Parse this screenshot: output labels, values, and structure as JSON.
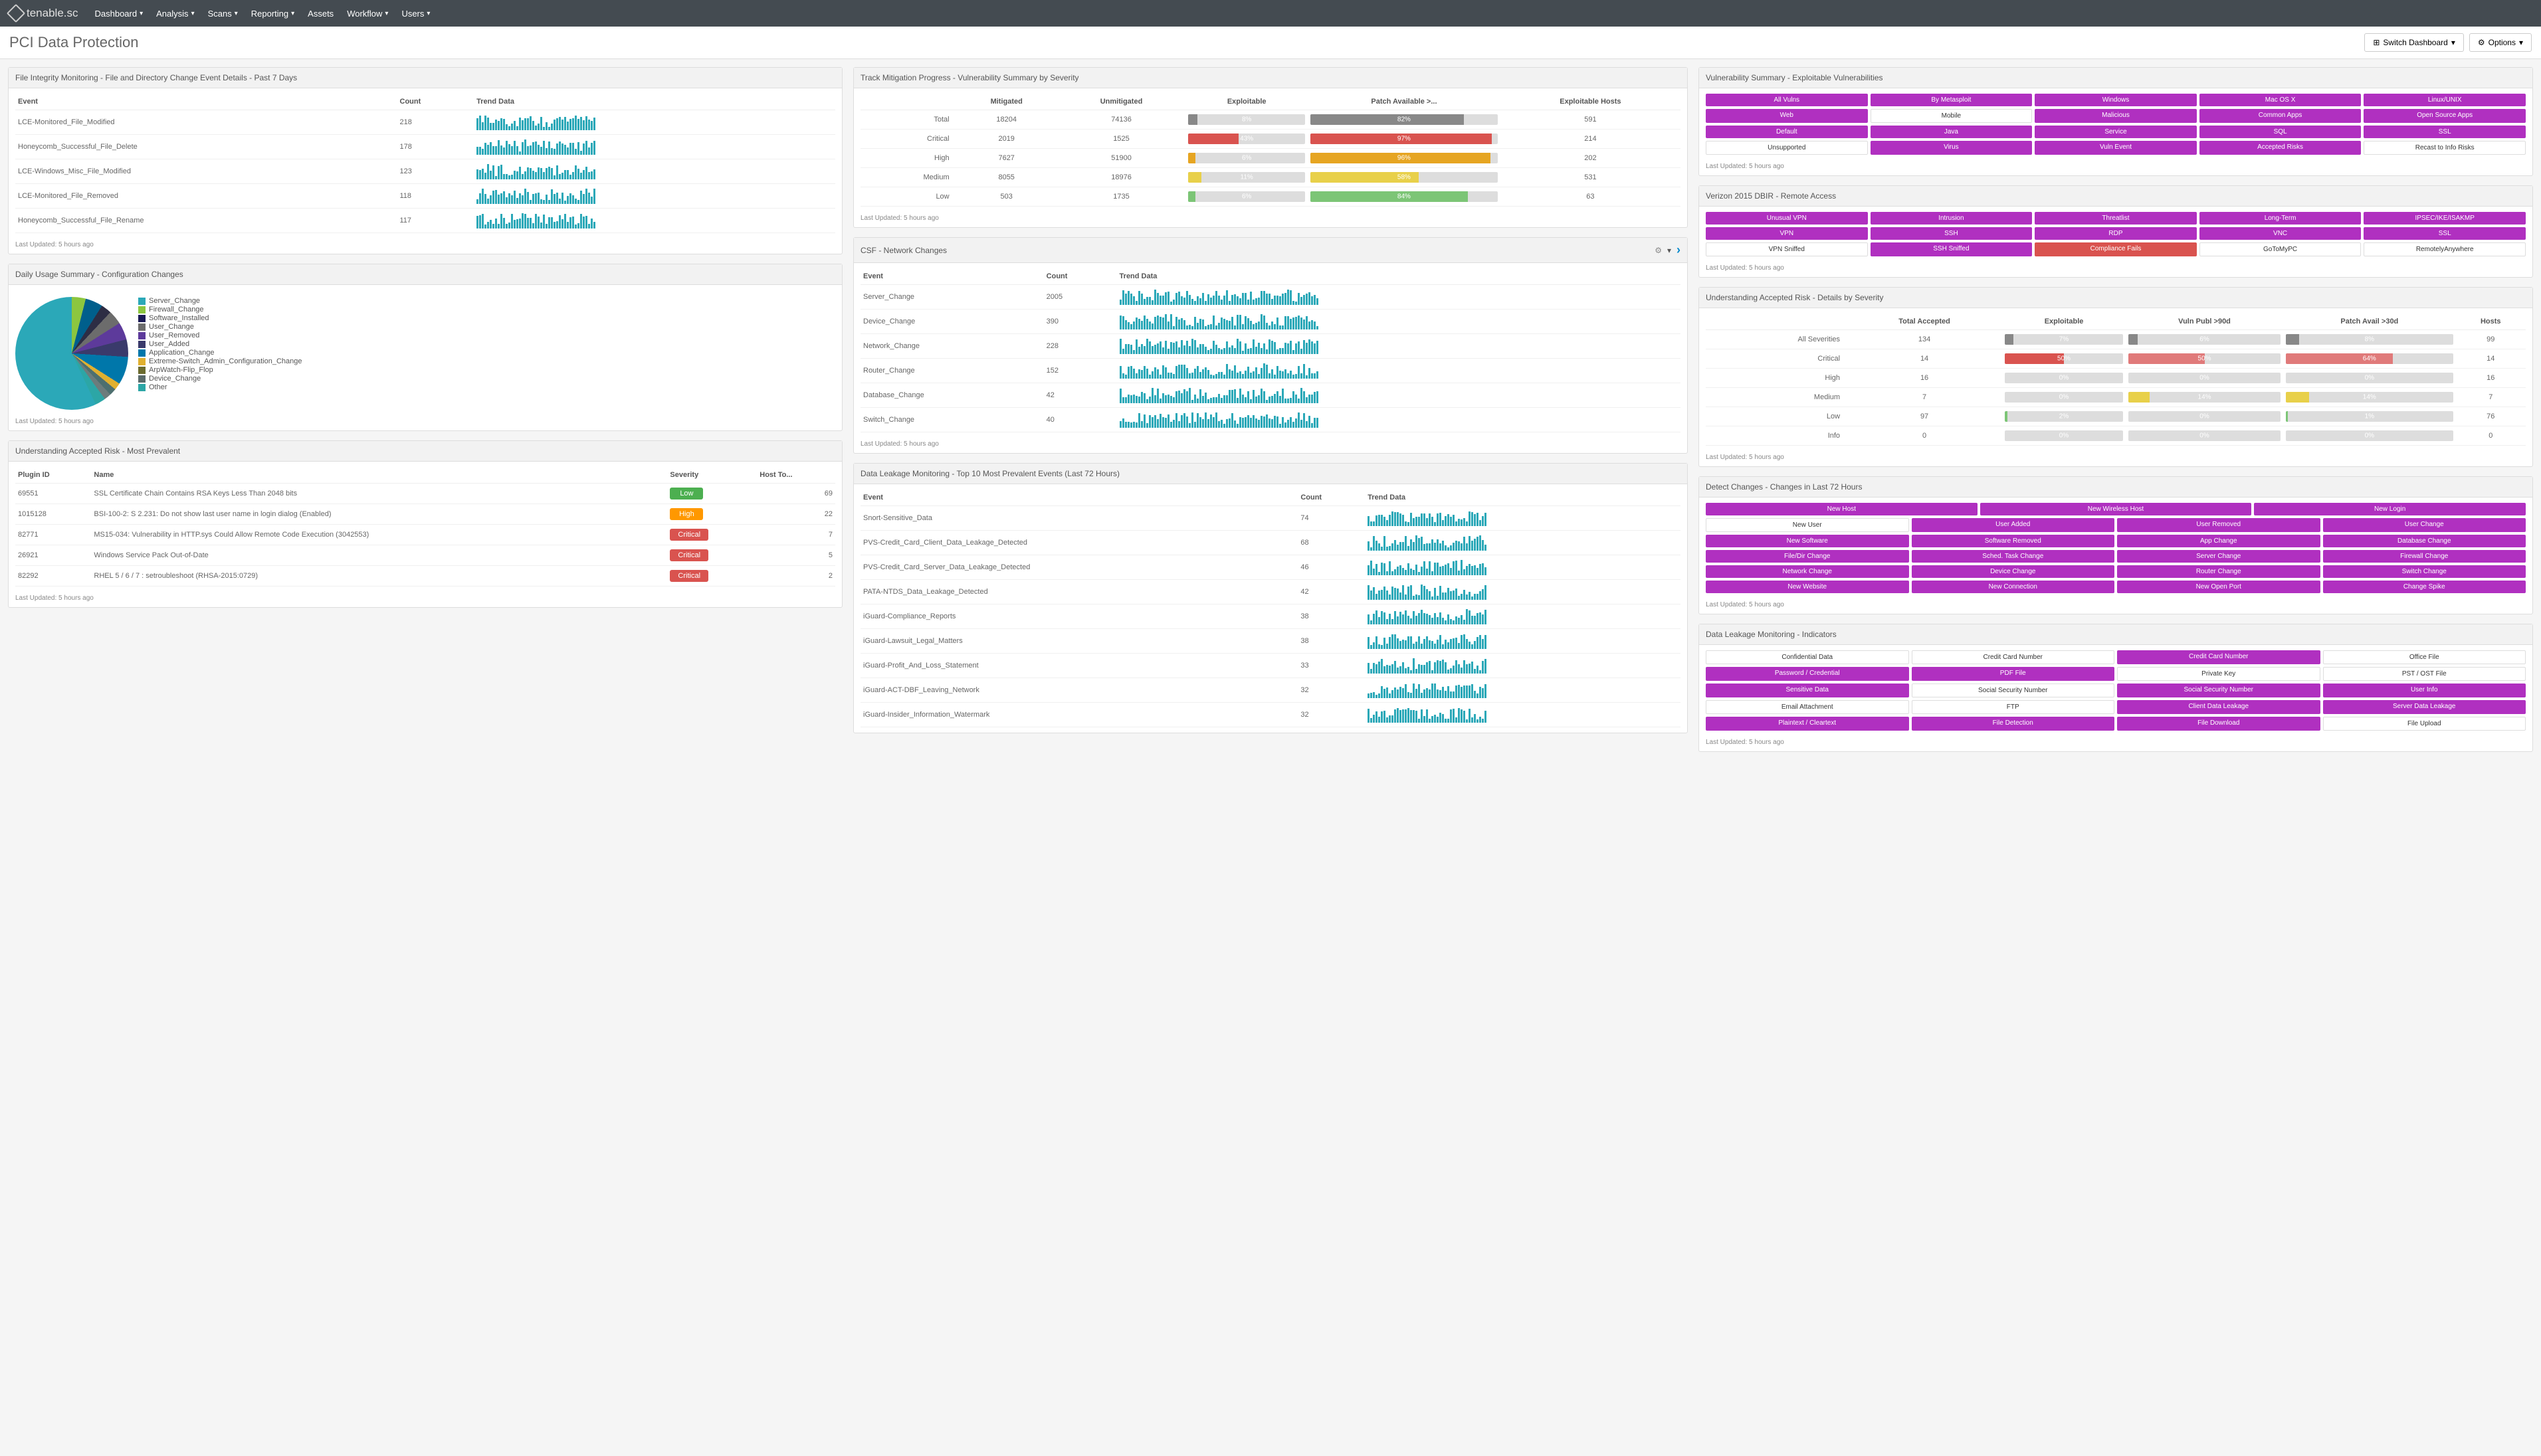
{
  "nav": {
    "logo": "tenable.sc",
    "items": [
      "Dashboard",
      "Analysis",
      "Scans",
      "Reporting",
      "Assets",
      "Workflow",
      "Users"
    ],
    "no_dropdown": [
      "Assets"
    ]
  },
  "page_title": "PCI Data Protection",
  "header_buttons": {
    "switch": "Switch Dashboard",
    "options": "Options"
  },
  "last_updated": "Last Updated: 5 hours ago",
  "panels": {
    "file_integrity": {
      "title": "File Integrity Monitoring - File and Directory Change Event Details - Past 7 Days",
      "columns": [
        "Event",
        "Count",
        "Trend Data"
      ],
      "rows": [
        {
          "event": "LCE-Monitored_File_Modified",
          "count": 218
        },
        {
          "event": "Honeycomb_Successful_File_Delete",
          "count": 178
        },
        {
          "event": "LCE-Windows_Misc_File_Modified",
          "count": 123
        },
        {
          "event": "LCE-Monitored_File_Removed",
          "count": 118
        },
        {
          "event": "Honeycomb_Successful_File_Rename",
          "count": 117
        }
      ]
    },
    "daily_usage": {
      "title": "Daily Usage Summary - Configuration Changes",
      "legend": [
        {
          "label": "Server_Change",
          "color": "#2ba8b8"
        },
        {
          "label": "Firewall_Change",
          "color": "#8cc63f"
        },
        {
          "label": "Software_Installed",
          "color": "#1a1a55"
        },
        {
          "label": "User_Change",
          "color": "#6c6c6c"
        },
        {
          "label": "User_Removed",
          "color": "#5d3a9b"
        },
        {
          "label": "User_Added",
          "color": "#3a3a6b"
        },
        {
          "label": "Application_Change",
          "color": "#0077aa"
        },
        {
          "label": "Extreme-Switch_Admin_Configuration_Change",
          "color": "#e0b030"
        },
        {
          "label": "ArpWatch-Flip_Flop",
          "color": "#6b6b2f"
        },
        {
          "label": "Device_Change",
          "color": "#5a6a6a"
        },
        {
          "label": "Other",
          "color": "#2ca6a6"
        }
      ]
    },
    "accepted_risk_prevalent": {
      "title": "Understanding Accepted Risk - Most Prevalent",
      "columns": [
        "Plugin ID",
        "Name",
        "Severity",
        "Host To..."
      ],
      "rows": [
        {
          "plugin_id": "69551",
          "name": "SSL Certificate Chain Contains RSA Keys Less Than 2048 bits",
          "severity": "Low",
          "hosts": 69
        },
        {
          "plugin_id": "1015128",
          "name": "BSI-100-2: S 2.231: Do not show last user name in login dialog (Enabled)",
          "severity": "High",
          "hosts": 22
        },
        {
          "plugin_id": "82771",
          "name": "MS15-034: Vulnerability in HTTP.sys Could Allow Remote Code Execution (3042553)",
          "severity": "Critical",
          "hosts": 7
        },
        {
          "plugin_id": "26921",
          "name": "Windows Service Pack Out-of-Date",
          "severity": "Critical",
          "hosts": 5
        },
        {
          "plugin_id": "82292",
          "name": "RHEL 5 / 6 / 7 : setroubleshoot (RHSA-2015:0729)",
          "severity": "Critical",
          "hosts": 2
        }
      ]
    },
    "mitigation": {
      "title": "Track Mitigation Progress - Vulnerability Summary by Severity",
      "columns": [
        "",
        "Mitigated",
        "Unmitigated",
        "Exploitable",
        "Patch Available >...",
        "Exploitable Hosts"
      ],
      "rows": [
        {
          "label": "Total",
          "mitigated": 18204,
          "unmitigated": 74136,
          "exploitable": {
            "pct": 8,
            "color": "#888"
          },
          "patch": {
            "pct": 82,
            "color": "#888"
          },
          "hosts": 591
        },
        {
          "label": "Critical",
          "mitigated": 2019,
          "unmitigated": 1525,
          "exploitable": {
            "pct": 43,
            "color": "#d9534f"
          },
          "patch": {
            "pct": 97,
            "color": "#d9534f"
          },
          "hosts": 214
        },
        {
          "label": "High",
          "mitigated": 7627,
          "unmitigated": 51900,
          "exploitable": {
            "pct": 6,
            "color": "#e6a522"
          },
          "patch": {
            "pct": 96,
            "color": "#e6a522"
          },
          "hosts": 202
        },
        {
          "label": "Medium",
          "mitigated": 8055,
          "unmitigated": 18976,
          "exploitable": {
            "pct": 11,
            "color": "#e8d04a"
          },
          "patch": {
            "pct": 58,
            "color": "#e8d04a"
          },
          "hosts": 531
        },
        {
          "label": "Low",
          "mitigated": 503,
          "unmitigated": 1735,
          "exploitable": {
            "pct": 6,
            "color": "#7cc576"
          },
          "patch": {
            "pct": 84,
            "color": "#7cc576"
          },
          "hosts": 63
        }
      ]
    },
    "csf_network": {
      "title": "CSF - Network Changes",
      "columns": [
        "Event",
        "Count",
        "Trend Data"
      ],
      "rows": [
        {
          "event": "Server_Change",
          "count": 2005
        },
        {
          "event": "Device_Change",
          "count": 390
        },
        {
          "event": "Network_Change",
          "count": 228
        },
        {
          "event": "Router_Change",
          "count": 152
        },
        {
          "event": "Database_Change",
          "count": 42
        },
        {
          "event": "Switch_Change",
          "count": 40
        }
      ]
    },
    "data_leakage_events": {
      "title": "Data Leakage Monitoring - Top 10 Most Prevalent Events (Last 72 Hours)",
      "columns": [
        "Event",
        "Count",
        "Trend Data"
      ],
      "rows": [
        {
          "event": "Snort-Sensitive_Data",
          "count": 74
        },
        {
          "event": "PVS-Credit_Card_Client_Data_Leakage_Detected",
          "count": 68
        },
        {
          "event": "PVS-Credit_Card_Server_Data_Leakage_Detected",
          "count": 46
        },
        {
          "event": "PATA-NTDS_Data_Leakage_Detected",
          "count": 42
        },
        {
          "event": "iGuard-Compliance_Reports",
          "count": 38
        },
        {
          "event": "iGuard-Lawsuit_Legal_Matters",
          "count": 38
        },
        {
          "event": "iGuard-Profit_And_Loss_Statement",
          "count": 33
        },
        {
          "event": "iGuard-ACT-DBF_Leaving_Network",
          "count": 32
        },
        {
          "event": "iGuard-Insider_Information_Watermark",
          "count": 32
        }
      ]
    },
    "vuln_exploitable": {
      "title": "Vulnerability Summary - Exploitable Vulnerabilities",
      "buttons": [
        {
          "t": "All Vulns"
        },
        {
          "t": "By Metasploit"
        },
        {
          "t": "Windows"
        },
        {
          "t": "Mac OS X"
        },
        {
          "t": "Linux/UNIX"
        },
        {
          "t": "Web"
        },
        {
          "t": "Mobile",
          "w": true
        },
        {
          "t": "Malicious"
        },
        {
          "t": "Common Apps"
        },
        {
          "t": "Open Source Apps"
        },
        {
          "t": "Default"
        },
        {
          "t": "Java"
        },
        {
          "t": "Service"
        },
        {
          "t": "SQL"
        },
        {
          "t": "SSL"
        },
        {
          "t": "Unsupported",
          "w": true
        },
        {
          "t": "Virus"
        },
        {
          "t": "Vuln Event"
        },
        {
          "t": "Accepted Risks"
        },
        {
          "t": "Recast to Info Risks",
          "w": true
        }
      ]
    },
    "dbir": {
      "title": "Verizon 2015 DBIR - Remote Access",
      "buttons": [
        {
          "t": "Unusual VPN"
        },
        {
          "t": "Intrusion"
        },
        {
          "t": "Threatlist"
        },
        {
          "t": "Long-Term"
        },
        {
          "t": "IPSEC/IKE/ISAKMP"
        },
        {
          "t": "VPN"
        },
        {
          "t": "SSH"
        },
        {
          "t": "RDP"
        },
        {
          "t": "VNC"
        },
        {
          "t": "SSL"
        },
        {
          "t": "VPN Sniffed",
          "w": true
        },
        {
          "t": "SSH Sniffed"
        },
        {
          "t": "Compliance Fails",
          "r": true
        },
        {
          "t": "GoToMyPC",
          "w": true
        },
        {
          "t": "RemotelyAnywhere",
          "w": true
        }
      ]
    },
    "accepted_risk_severity": {
      "title": "Understanding Accepted Risk - Details by Severity",
      "columns": [
        "",
        "Total Accepted",
        "Exploitable",
        "Vuln Publ >90d",
        "Patch Avail >30d",
        "Hosts"
      ],
      "rows": [
        {
          "label": "All Severities",
          "total": 134,
          "exploitable": {
            "pct": 7,
            "color": "#888"
          },
          "vuln_publ": {
            "pct": 6,
            "color": "#888"
          },
          "patch": {
            "pct": 8,
            "color": "#888"
          },
          "hosts": 99
        },
        {
          "label": "Critical",
          "total": 14,
          "exploitable": {
            "pct": 50,
            "color": "#d9534f"
          },
          "vuln_publ": {
            "pct": 50,
            "color": "#e07a7a"
          },
          "patch": {
            "pct": 64,
            "color": "#e07a7a"
          },
          "hosts": 14
        },
        {
          "label": "High",
          "total": 16,
          "exploitable": {
            "pct": 0,
            "color": "#e6a522"
          },
          "vuln_publ": {
            "pct": 0,
            "color": "#e6a522"
          },
          "patch": {
            "pct": 0,
            "color": "#e6a522"
          },
          "hosts": 16
        },
        {
          "label": "Medium",
          "total": 7,
          "exploitable": {
            "pct": 0,
            "color": "#e8d04a"
          },
          "vuln_publ": {
            "pct": 14,
            "color": "#e8d04a"
          },
          "patch": {
            "pct": 14,
            "color": "#e8d04a"
          },
          "hosts": 7
        },
        {
          "label": "Low",
          "total": 97,
          "exploitable": {
            "pct": 2,
            "color": "#7cc576"
          },
          "vuln_publ": {
            "pct": 0,
            "color": "#7cc576"
          },
          "patch": {
            "pct": 1,
            "color": "#7cc576"
          },
          "hosts": 76
        },
        {
          "label": "Info",
          "total": 0,
          "exploitable": {
            "pct": 0,
            "color": "#b0c4cc"
          },
          "vuln_publ": {
            "pct": 0,
            "color": "#b0c4cc"
          },
          "patch": {
            "pct": 0,
            "color": "#b0c4cc"
          },
          "hosts": 0
        }
      ]
    },
    "detect_changes": {
      "title": "Detect Changes - Changes in Last 72 Hours",
      "buttons": [
        {
          "t": "New Host"
        },
        {
          "t": "New Wireless Host"
        },
        {
          "t": "New Login"
        },
        {
          "t": "New User",
          "w": true
        },
        {
          "t": "User Added"
        },
        {
          "t": "User Removed"
        },
        {
          "t": "User Change"
        },
        {
          "t": "New Software"
        },
        {
          "t": "Software Removed"
        },
        {
          "t": "App Change"
        },
        {
          "t": "Database Change"
        },
        {
          "t": "File/Dir Change"
        },
        {
          "t": "Sched. Task Change"
        },
        {
          "t": "Server Change"
        },
        {
          "t": "Firewall Change"
        },
        {
          "t": "Network Change"
        },
        {
          "t": "Device Change"
        },
        {
          "t": "Router Change"
        },
        {
          "t": "Switch Change"
        },
        {
          "t": "New Website"
        },
        {
          "t": "New Connection"
        },
        {
          "t": "New Open Port"
        },
        {
          "t": "Change Spike"
        }
      ]
    },
    "data_leakage_indicators": {
      "title": "Data Leakage Monitoring - Indicators",
      "buttons": [
        {
          "t": "Confidential Data",
          "w": true
        },
        {
          "t": "Credit Card Number",
          "w": true
        },
        {
          "t": "Credit Card Number"
        },
        {
          "t": "Office File",
          "w": true
        },
        {
          "t": "Password / Credential"
        },
        {
          "t": "PDF File"
        },
        {
          "t": "Private Key",
          "w": true
        },
        {
          "t": "PST / OST File",
          "w": true
        },
        {
          "t": "Sensitive Data"
        },
        {
          "t": "Social Security Number",
          "w": true
        },
        {
          "t": "Social Security Number"
        },
        {
          "t": "User Info"
        },
        {
          "t": "Email Attachment",
          "w": true
        },
        {
          "t": "FTP",
          "w": true
        },
        {
          "t": "Client Data Leakage"
        },
        {
          "t": "Server Data Leakage"
        },
        {
          "t": "Plaintext / Cleartext"
        },
        {
          "t": "File Detection"
        },
        {
          "t": "File Download"
        },
        {
          "t": "File Upload",
          "w": true
        }
      ]
    }
  },
  "chart_data": {
    "type": "pie",
    "title": "Daily Usage Summary - Configuration Changes",
    "series": [
      {
        "name": "Server_Change",
        "value": 57,
        "color": "#2ba8b8"
      },
      {
        "name": "Firewall_Change",
        "value": 4,
        "color": "#8cc63f"
      },
      {
        "name": "Software_Installed",
        "value": 5,
        "color": "#1a1a55"
      },
      {
        "name": "User_Change",
        "value": 3,
        "color": "#6c6c6c"
      },
      {
        "name": "User_Removed",
        "value": 4,
        "color": "#5d3a9b"
      },
      {
        "name": "User_Added",
        "value": 5,
        "color": "#3a3a6b"
      },
      {
        "name": "Application_Change",
        "value": 5,
        "color": "#0077aa"
      },
      {
        "name": "Extreme-Switch_Admin_Configuration_Change",
        "value": 8,
        "color": "#e0b030"
      },
      {
        "name": "ArpWatch-Flip_Flop",
        "value": 2,
        "color": "#6b6b2f"
      },
      {
        "name": "Device_Change",
        "value": 2,
        "color": "#5a6a6a"
      },
      {
        "name": "Other",
        "value": 3,
        "color": "#2ca6a6"
      }
    ]
  }
}
